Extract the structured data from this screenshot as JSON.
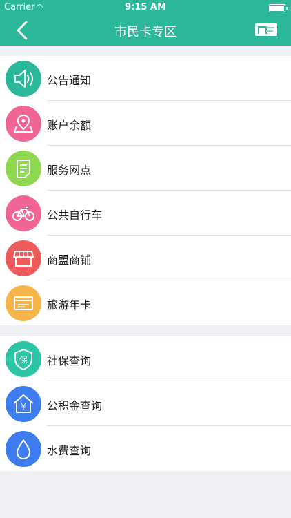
{
  "status": {
    "carrier": "Carrier",
    "time": "9:15 AM"
  },
  "nav": {
    "title": "市民卡专区"
  },
  "groups": [
    {
      "items": [
        {
          "label": "公告通知",
          "icon": "speaker-icon",
          "color": "#2bb89a"
        },
        {
          "label": "账户余额",
          "icon": "location-map-icon",
          "color": "#f06596"
        },
        {
          "label": "服务网点",
          "icon": "document-icon",
          "color": "#8ed84f"
        },
        {
          "label": "公共自行车",
          "icon": "bicycle-icon",
          "color": "#f06596"
        },
        {
          "label": "商盟商铺",
          "icon": "store-icon",
          "color": "#ef5b5b"
        },
        {
          "label": "旅游年卡",
          "icon": "ticket-card-icon",
          "color": "#f6b44a"
        }
      ]
    },
    {
      "items": [
        {
          "label": "社保查询",
          "icon": "shield-bao-icon",
          "color": "#2bc5a6"
        },
        {
          "label": "公积金查询",
          "icon": "house-yen-icon",
          "color": "#3d7df0"
        },
        {
          "label": "水费查询",
          "icon": "water-drop-icon",
          "color": "#3d7df0"
        }
      ]
    }
  ]
}
